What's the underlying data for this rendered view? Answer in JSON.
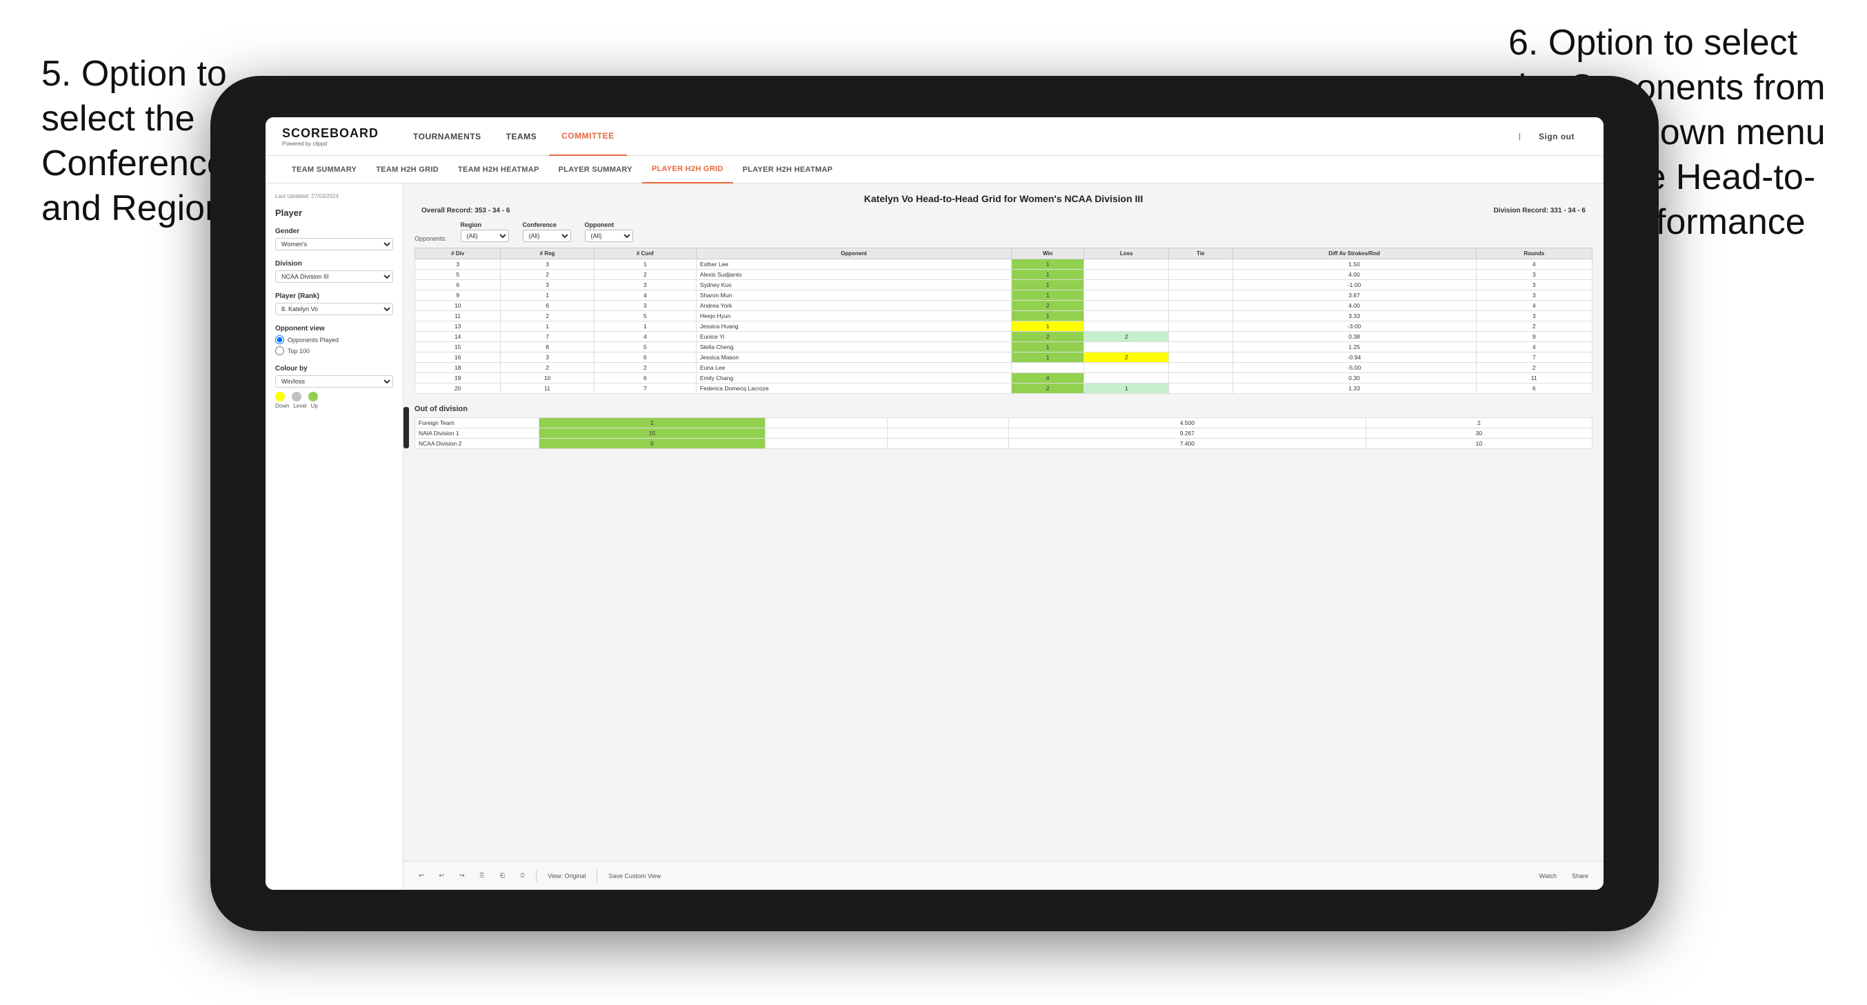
{
  "annotations": {
    "left": {
      "text": "5. Option to select the Conference and Region"
    },
    "right": {
      "text": "6. Option to select the Opponents from the dropdown menu to see the Head-to-Head performance"
    }
  },
  "nav": {
    "logo": "SCOREBOARD",
    "logo_sub": "Powered by clippd",
    "items": [
      "TOURNAMENTS",
      "TEAMS",
      "COMMITTEE"
    ],
    "active_item": "COMMITTEE",
    "sign_out": "Sign out"
  },
  "sub_nav": {
    "items": [
      "TEAM SUMMARY",
      "TEAM H2H GRID",
      "TEAM H2H HEATMAP",
      "PLAYER SUMMARY",
      "PLAYER H2H GRID",
      "PLAYER H2H HEATMAP"
    ],
    "active_item": "PLAYER H2H GRID"
  },
  "sidebar": {
    "last_updated_label": "Last Updated: 27/03/2024",
    "player_label": "Player",
    "gender_label": "Gender",
    "gender_value": "Women's",
    "division_label": "Division",
    "division_value": "NCAA Division III",
    "player_rank_label": "Player (Rank)",
    "player_rank_value": "8. Katelyn Vo",
    "opponent_view_label": "Opponent view",
    "opponent_options": [
      "Opponents Played",
      "Top 100"
    ],
    "colour_by_label": "Colour by",
    "colour_by_value": "Win/loss",
    "colour_labels": [
      "Down",
      "Level",
      "Up"
    ]
  },
  "grid": {
    "title": "Katelyn Vo Head-to-Head Grid for Women's NCAA Division III",
    "overall_record_label": "Overall Record:",
    "overall_record": "353 - 34 - 6",
    "division_record_label": "Division Record:",
    "division_record": "331 - 34 - 6",
    "filters": {
      "opponents_label": "Opponents:",
      "region_label": "Region",
      "region_value": "(All)",
      "conference_label": "Conference",
      "conference_value": "(All)",
      "opponent_label": "Opponent",
      "opponent_value": "(All)"
    },
    "columns": [
      "# Div",
      "# Reg",
      "# Conf",
      "Opponent",
      "Win",
      "Loss",
      "Tie",
      "Diff Av Strokes/Rnd",
      "Rounds"
    ],
    "rows": [
      {
        "div": "3",
        "reg": "3",
        "conf": "1",
        "opponent": "Esther Lee",
        "win": "1",
        "loss": "",
        "tie": "",
        "diff": "1.50",
        "rounds": "4",
        "win_color": "green",
        "loss_color": "",
        "tie_color": ""
      },
      {
        "div": "5",
        "reg": "2",
        "conf": "2",
        "opponent": "Alexis Sudjianto",
        "win": "1",
        "loss": "",
        "tie": "",
        "diff": "4.00",
        "rounds": "3",
        "win_color": "green"
      },
      {
        "div": "6",
        "reg": "3",
        "conf": "3",
        "opponent": "Sydney Kuo",
        "win": "1",
        "loss": "",
        "tie": "",
        "diff": "-1.00",
        "rounds": "3",
        "win_color": "green"
      },
      {
        "div": "9",
        "reg": "1",
        "conf": "4",
        "opponent": "Sharon Mun",
        "win": "1",
        "loss": "",
        "tie": "",
        "diff": "3.67",
        "rounds": "3",
        "win_color": "green"
      },
      {
        "div": "10",
        "reg": "6",
        "conf": "3",
        "opponent": "Andrea York",
        "win": "2",
        "loss": "",
        "tie": "",
        "diff": "4.00",
        "rounds": "4",
        "win_color": "green"
      },
      {
        "div": "11",
        "reg": "2",
        "conf": "5",
        "opponent": "Heejo Hyun",
        "win": "1",
        "loss": "",
        "tie": "",
        "diff": "3.33",
        "rounds": "3",
        "win_color": "green"
      },
      {
        "div": "13",
        "reg": "1",
        "conf": "1",
        "opponent": "Jessica Huang",
        "win": "1",
        "loss": "",
        "tie": "",
        "diff": "-3.00",
        "rounds": "2",
        "win_color": "yellow"
      },
      {
        "div": "14",
        "reg": "7",
        "conf": "4",
        "opponent": "Eunice Yi",
        "win": "2",
        "loss": "2",
        "tie": "",
        "diff": "0.38",
        "rounds": "9",
        "win_color": "green",
        "loss_color": "light-green"
      },
      {
        "div": "15",
        "reg": "8",
        "conf": "5",
        "opponent": "Stella Cheng",
        "win": "1",
        "loss": "",
        "tie": "",
        "diff": "1.25",
        "rounds": "4",
        "win_color": "green"
      },
      {
        "div": "16",
        "reg": "3",
        "conf": "6",
        "opponent": "Jessica Mason",
        "win": "1",
        "loss": "2",
        "tie": "",
        "diff": "-0.94",
        "rounds": "7",
        "win_color": "green",
        "loss_color": "yellow"
      },
      {
        "div": "18",
        "reg": "2",
        "conf": "2",
        "opponent": "Euna Lee",
        "win": "",
        "loss": "",
        "tie": "",
        "diff": "-5.00",
        "rounds": "2",
        "win_color": ""
      },
      {
        "div": "19",
        "reg": "10",
        "conf": "6",
        "opponent": "Emily Chang",
        "win": "4",
        "loss": "",
        "tie": "",
        "diff": "0.30",
        "rounds": "11",
        "win_color": "green"
      },
      {
        "div": "20",
        "reg": "11",
        "conf": "7",
        "opponent": "Federica Domecq Lacroze",
        "win": "2",
        "loss": "1",
        "tie": "",
        "diff": "1.33",
        "rounds": "6",
        "win_color": "green",
        "loss_color": "light-green"
      }
    ],
    "out_of_division_title": "Out of division",
    "out_of_division_rows": [
      {
        "opponent": "Foreign Team",
        "win": "1",
        "loss": "",
        "tie": "",
        "diff": "4.500",
        "rounds": "2"
      },
      {
        "opponent": "NAIA Division 1",
        "win": "15",
        "loss": "",
        "tie": "",
        "diff": "9.267",
        "rounds": "30"
      },
      {
        "opponent": "NCAA Division 2",
        "win": "5",
        "loss": "",
        "tie": "",
        "diff": "7.400",
        "rounds": "10"
      }
    ]
  },
  "toolbar": {
    "view_original": "View: Original",
    "save_custom": "Save Custom View",
    "watch": "Watch",
    "share": "Share"
  },
  "colors": {
    "green": "#92d050",
    "yellow": "#ffff00",
    "light_green": "#c6efce",
    "orange": "#ffc000",
    "accent": "#e8673a",
    "circle_down": "#ffff00",
    "circle_level": "#c0c0c0",
    "circle_up": "#92d050"
  }
}
